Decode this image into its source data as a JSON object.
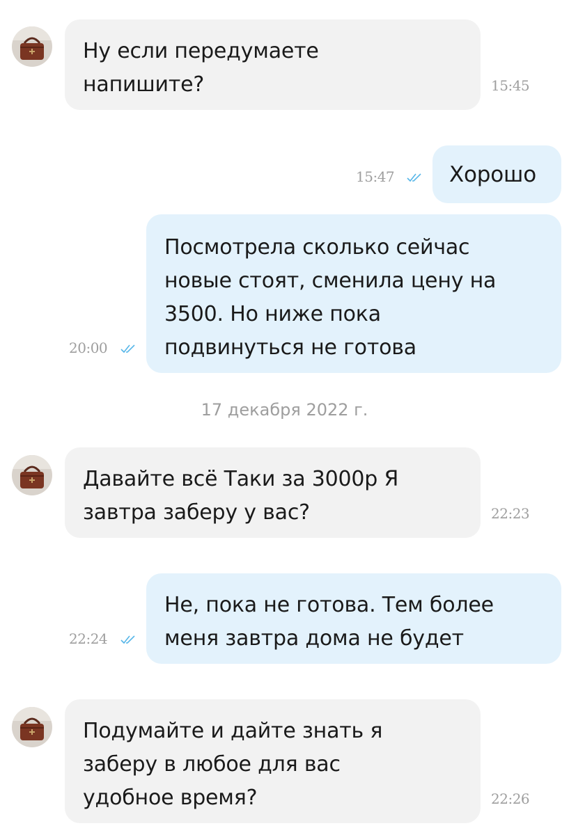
{
  "colors": {
    "incoming_bubble": "#f2f2f2",
    "outgoing_bubble": "#e3f2fc",
    "meta_text": "#9e9e9e",
    "read_check": "#56b6e8"
  },
  "messages": [
    {
      "direction": "incoming",
      "lines": [
        "Ну если передумаете",
        "напишите?"
      ],
      "time": "15:45"
    },
    {
      "direction": "outgoing",
      "lines": [
        "Хорошо"
      ],
      "time": "15:47",
      "status_icon": "double-check-icon"
    },
    {
      "direction": "outgoing",
      "lines": [
        "Посмотрела сколько сейчас",
        "новые стоят, сменила цену на",
        "3500. Но ниже пока",
        "подвинуться не готова"
      ],
      "time": "20:00",
      "status_icon": "double-check-icon"
    },
    {
      "direction": "incoming",
      "lines": [
        "Давайте всё Таки за 3000р Я",
        "завтра заберу у вас?"
      ],
      "time": "22:23"
    },
    {
      "direction": "outgoing",
      "lines": [
        "Не, пока не готова. Тем более",
        "меня завтра дома не будет"
      ],
      "time": "22:24",
      "status_icon": "double-check-icon"
    },
    {
      "direction": "incoming",
      "lines": [
        "Подумайте и дайте знать я",
        "заберу в любое для вас",
        "удобное время?"
      ],
      "time": "22:26"
    }
  ],
  "date_separator": "17 декабря 2022 г."
}
